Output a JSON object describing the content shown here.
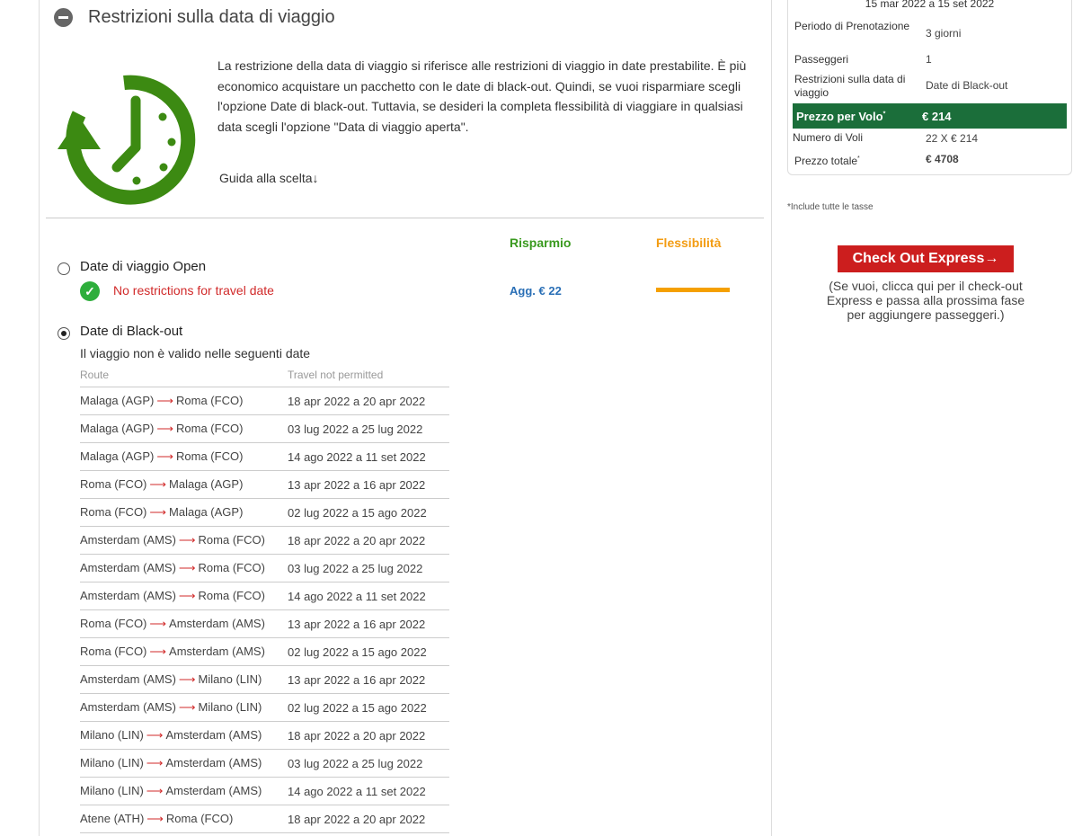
{
  "section": {
    "title": "Restrizioni sulla data di viaggio",
    "description": "La restrizione della data di viaggio si riferisce alle restrizioni di viaggio in date prestabilite. È più economico acquistare un pacchetto con le date di black-out. Quindi, se vuoi risparmiare scegli l'opzione Date di black-out. Tuttavia, se desideri la completa flessibilità di viaggiare in qualsiasi data scegli l'opzione \"Data di viaggio aperta\".",
    "guide_link": "Guida alla scelta↓"
  },
  "columns": {
    "savings": "Risparmio",
    "flexibility": "Flessibilità"
  },
  "option_open": {
    "label": "Date di viaggio Open",
    "note": "No restrictions for travel date",
    "price_add": "Agg. € 22",
    "flexibility_level": 1.0
  },
  "option_blackout": {
    "label": "Date di Black-out",
    "not_valid": "Il viaggio non è valido nelle seguenti date",
    "table_headers": {
      "route": "Route",
      "not_permitted": "Travel not permitted"
    },
    "rows": [
      {
        "from": "Malaga (AGP)",
        "to": "Roma (FCO)",
        "dates": "18 apr 2022 a 20 apr 2022"
      },
      {
        "from": "Malaga (AGP)",
        "to": "Roma (FCO)",
        "dates": "03 lug 2022 a 25 lug 2022"
      },
      {
        "from": "Malaga (AGP)",
        "to": "Roma (FCO)",
        "dates": "14 ago 2022 a 11 set 2022"
      },
      {
        "from": "Roma (FCO)",
        "to": "Malaga (AGP)",
        "dates": "13 apr 2022 a 16 apr 2022"
      },
      {
        "from": "Roma (FCO)",
        "to": "Malaga (AGP)",
        "dates": "02 lug 2022 a 15 ago 2022"
      },
      {
        "from": "Amsterdam (AMS)",
        "to": "Roma (FCO)",
        "dates": "18 apr 2022 a 20 apr 2022"
      },
      {
        "from": "Amsterdam (AMS)",
        "to": "Roma (FCO)",
        "dates": "03 lug 2022 a 25 lug 2022"
      },
      {
        "from": "Amsterdam (AMS)",
        "to": "Roma (FCO)",
        "dates": "14 ago 2022 a 11 set 2022"
      },
      {
        "from": "Roma (FCO)",
        "to": "Amsterdam (AMS)",
        "dates": "13 apr 2022 a 16 apr 2022"
      },
      {
        "from": "Roma (FCO)",
        "to": "Amsterdam (AMS)",
        "dates": "02 lug 2022 a 15 ago 2022"
      },
      {
        "from": "Amsterdam (AMS)",
        "to": "Milano (LIN)",
        "dates": "13 apr 2022 a 16 apr 2022"
      },
      {
        "from": "Amsterdam (AMS)",
        "to": "Milano (LIN)",
        "dates": "02 lug 2022 a 15 ago 2022"
      },
      {
        "from": "Milano (LIN)",
        "to": "Amsterdam (AMS)",
        "dates": "18 apr 2022 a 20 apr 2022"
      },
      {
        "from": "Milano (LIN)",
        "to": "Amsterdam (AMS)",
        "dates": "03 lug 2022 a 25 lug 2022"
      },
      {
        "from": "Milano (LIN)",
        "to": "Amsterdam (AMS)",
        "dates": "14 ago 2022 a 11 set 2022"
      },
      {
        "from": "Atene (ATH)",
        "to": "Roma (FCO)",
        "dates": "18 apr 2022 a 20 apr 2022"
      }
    ]
  },
  "summary": {
    "validity": "15 mar 2022 a 15 set 2022",
    "booking_period_label": "Periodo di Prenotazione",
    "booking_period_value": "3 giorni",
    "passengers_label": "Passeggeri",
    "passengers_value": "1",
    "date_restr_label": "Restrizioni sulla data di viaggio",
    "date_restr_value": "Date di Black-out",
    "price_per_flight_label": "Prezzo per Volo",
    "price_per_flight_value": "€ 214",
    "num_flights_label": "Numero di Voli",
    "num_flights_value": "22 X € 214",
    "total_label": "Prezzo totale",
    "total_value": "€ 4708"
  },
  "taxes_note": "*Include tutte le tasse",
  "checkout": {
    "label": "Check Out Express→",
    "note": "(Se vuoi, clicca qui per il check-out Express e passa alla prossima fase per aggiungere passeggeri.)"
  },
  "colors": {
    "green": "#1b6e3a",
    "red": "#cc1e1e",
    "orange": "#f5a000"
  },
  "icons": [
    "minus-circle-icon",
    "clock-rewind-icon",
    "check-circle-icon",
    "arrow-right-icon"
  ]
}
